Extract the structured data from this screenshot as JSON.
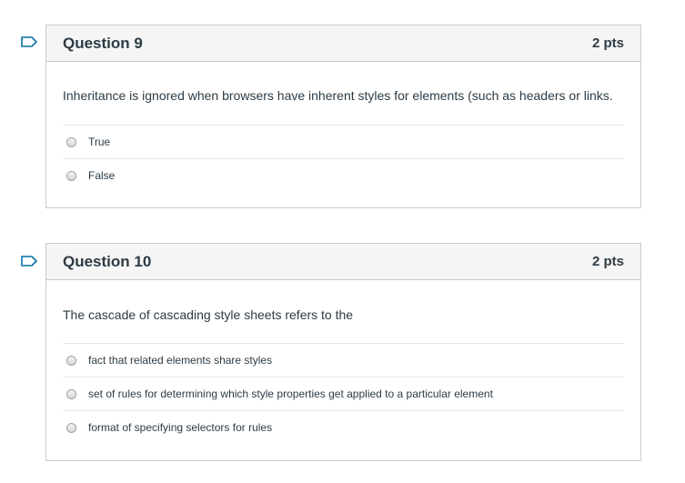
{
  "questions": [
    {
      "title": "Question 9",
      "points": "2 pts",
      "text": "Inheritance is ignored when browsers have inherent styles for elements (such as headers or links.",
      "answers": [
        "True",
        "False"
      ]
    },
    {
      "title": "Question 10",
      "points": "2 pts",
      "text": "The cascade of cascading style sheets refers to the",
      "answers": [
        "fact that related elements share styles",
        "set of rules for determining which style properties get applied to a particular element",
        "format of specifying selectors for rules"
      ]
    }
  ],
  "colors": {
    "flag": "#0770a3",
    "border": "#c7cdd1",
    "header_bg": "#f5f5f5"
  },
  "icons": {
    "flag": "bookmark-flag-icon",
    "radio": "radio-button-icon"
  }
}
